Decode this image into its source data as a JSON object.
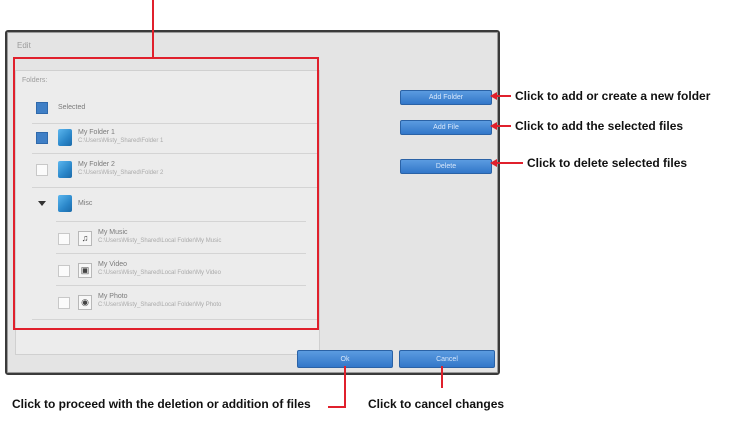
{
  "dialog": {
    "title": "Edit",
    "folders_label": "Folders:",
    "items": [
      {
        "name": "Selected",
        "path": "",
        "checked": true,
        "kind": "folder-check"
      },
      {
        "name": "My Folder 1",
        "path": "C:\\Users\\Misty_Shared\\Folder 1",
        "checked": true,
        "kind": "folder"
      },
      {
        "name": "My Folder 2",
        "path": "C:\\Users\\Misty_Shared\\Folder 2",
        "checked": false,
        "kind": "folder"
      },
      {
        "name": "Misc",
        "path": "",
        "checked": false,
        "kind": "group"
      },
      {
        "name": "My Music",
        "path": "C:\\Users\\Misty_Shared\\Local Folder\\My Music",
        "checked": false,
        "kind": "music"
      },
      {
        "name": "My Video",
        "path": "C:\\Users\\Misty_Shared\\Local Folder\\My Video",
        "checked": false,
        "kind": "video"
      },
      {
        "name": "My Photo",
        "path": "C:\\Users\\Misty_Shared\\Local Folder\\My Photo",
        "checked": false,
        "kind": "photo"
      }
    ],
    "buttons": {
      "add_folder": "Add Folder",
      "add_file": "Add File",
      "delete": "Delete",
      "ok": "Ok",
      "cancel": "Cancel"
    }
  },
  "annotations": {
    "add_folder": "Click to add or create a new folder",
    "add_file": "Click to add the selected files",
    "delete": "Click to delete selected files",
    "ok": "Click to proceed with the deletion or addition of files",
    "cancel": "Click to cancel changes"
  },
  "colors": {
    "accent": "#e0202c",
    "button": "#3f86d6",
    "checkbox": "#3f7fc6"
  }
}
